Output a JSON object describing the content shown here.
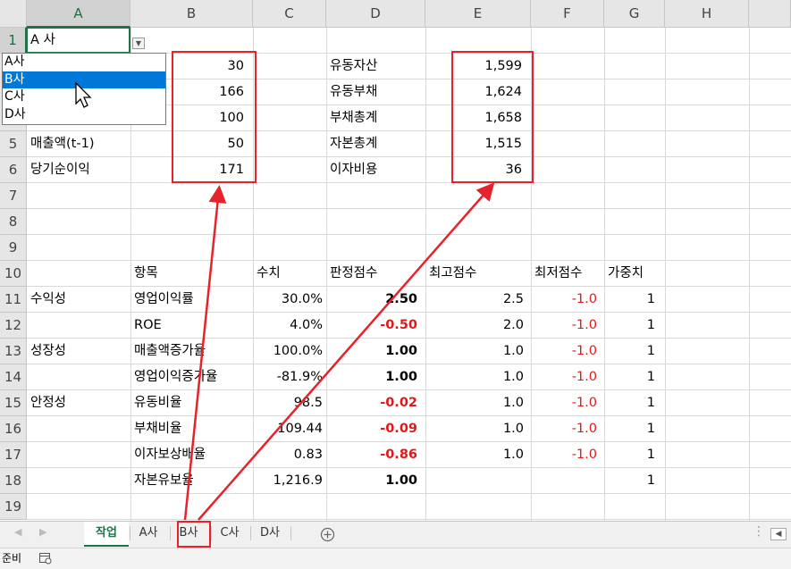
{
  "columns": [
    "A",
    "B",
    "C",
    "D",
    "E",
    "F",
    "G",
    "H"
  ],
  "rows": [
    "1",
    "5",
    "6",
    "7",
    "8",
    "9",
    "10",
    "11",
    "12",
    "13",
    "14",
    "15",
    "16",
    "17",
    "18",
    "19"
  ],
  "active_cell_value": "A 사",
  "dropdown": {
    "options": [
      "A사",
      "B사",
      "C사",
      "D사"
    ],
    "highlighted": "B사"
  },
  "input_rows": [
    {
      "label": "",
      "b": "30",
      "d": "유동자산",
      "e": "1,599"
    },
    {
      "label": "",
      "b": "166",
      "d": "유동부채",
      "e": "1,624"
    },
    {
      "label": "",
      "b": "100",
      "d": "부채총계",
      "e": "1,658"
    },
    {
      "label": "매출액(t-1)",
      "b": "50",
      "d": "자본총계",
      "e": "1,515"
    },
    {
      "label": "당기순이익",
      "b": "171",
      "d": "이자비용",
      "e": "36"
    }
  ],
  "table_header": {
    "b": "항목",
    "c": "수치",
    "d": "판정점수",
    "e": "최고점수",
    "f": "최저점수",
    "g": "가중치"
  },
  "table_rows": [
    {
      "a": "수익성",
      "b": "영업이익률",
      "c": "30.0%",
      "d": "2.50",
      "e": "2.5",
      "f": "-1.0",
      "g": "1"
    },
    {
      "a": "",
      "b": "ROE",
      "c": "4.0%",
      "d": "-0.50",
      "e": "2.0",
      "f": "-1.0",
      "g": "1"
    },
    {
      "a": "성장성",
      "b": "매출액증가율",
      "c": "100.0%",
      "d": "1.00",
      "e": "1.0",
      "f": "-1.0",
      "g": "1"
    },
    {
      "a": "",
      "b": "영업이익증가율",
      "c": "-81.9%",
      "d": "1.00",
      "e": "1.0",
      "f": "-1.0",
      "g": "1"
    },
    {
      "a": "안정성",
      "b": "유동비율",
      "c": "98.5",
      "d": "-0.02",
      "e": "1.0",
      "f": "-1.0",
      "g": "1"
    },
    {
      "a": "",
      "b": "부채비율",
      "c": "109.44",
      "d": "-0.09",
      "e": "1.0",
      "f": "-1.0",
      "g": "1"
    },
    {
      "a": "",
      "b": "이자보상배율",
      "c": "0.83",
      "d": "-0.86",
      "e": "1.0",
      "f": "-1.0",
      "g": "1"
    },
    {
      "a": "",
      "b": "자본유보율",
      "c": "1,216.9",
      "d": "1.00",
      "e": "",
      "f": "",
      "g": "1"
    }
  ],
  "sheet_tabs": [
    "작업",
    "A사",
    "B사",
    "C사",
    "D사"
  ],
  "active_tab": "작업",
  "status": "준비",
  "colors": {
    "accent": "#217346",
    "highlight_box": "#e8222b",
    "negative": "#e01a1a",
    "selection": "#0078d7"
  }
}
